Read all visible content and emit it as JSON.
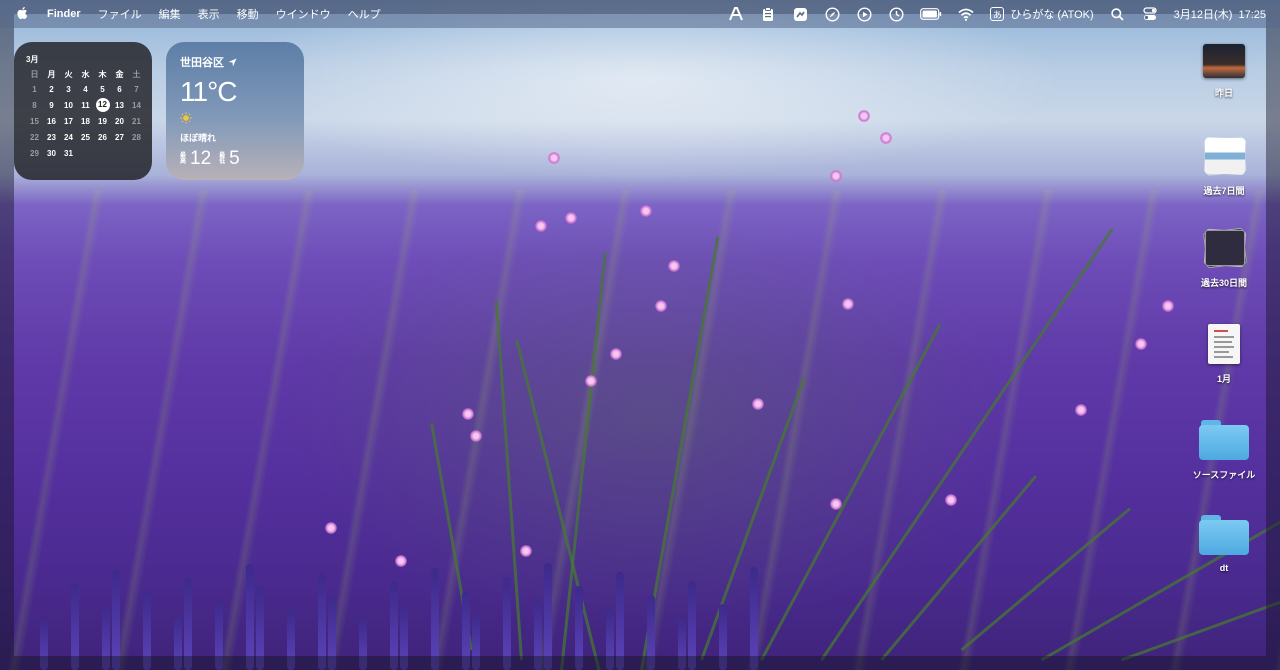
{
  "menubar": {
    "app_name": "Finder",
    "menus": [
      "ファイル",
      "編集",
      "表示",
      "移動",
      "ウインドウ",
      "ヘルプ"
    ],
    "status_icons": [
      "atok-icon",
      "clipboard-icon",
      "screenshot-icon",
      "safari-compass-icon",
      "play-icon",
      "clock-icon",
      "battery-icon",
      "wifi-icon"
    ],
    "input_method": "ひらがな (ATOK)",
    "datetime": "3月12日(木)  17:25"
  },
  "calendar": {
    "month": "3月",
    "weekdays": [
      "日",
      "月",
      "火",
      "水",
      "木",
      "金",
      "土"
    ],
    "weeks": [
      [
        "1",
        "2",
        "3",
        "4",
        "5",
        "6",
        "7"
      ],
      [
        "8",
        "9",
        "10",
        "11",
        "12",
        "13",
        "14"
      ],
      [
        "15",
        "16",
        "17",
        "18",
        "19",
        "20",
        "21"
      ],
      [
        "22",
        "23",
        "24",
        "25",
        "26",
        "27",
        "28"
      ],
      [
        "29",
        "30",
        "31",
        "",
        "",
        "",
        ""
      ]
    ],
    "today": "12"
  },
  "weather": {
    "location": "世田谷区",
    "temp": "11°C",
    "condition": "ほぼ晴れ",
    "high_label": "最高",
    "high": "12",
    "low_label": "最低",
    "low": "5"
  },
  "desktop_items": [
    {
      "label": "昨日",
      "kind": "photo"
    },
    {
      "label": "過去7日間",
      "kind": "stack"
    },
    {
      "label": "過去30日間",
      "kind": "stack-dark"
    },
    {
      "label": "1月",
      "kind": "document"
    },
    {
      "label": "ソースファイル",
      "kind": "folder"
    },
    {
      "label": "dt",
      "kind": "folder"
    }
  ],
  "colors": {
    "folder": "#5fb4e8",
    "menubar": "#5a698c"
  }
}
